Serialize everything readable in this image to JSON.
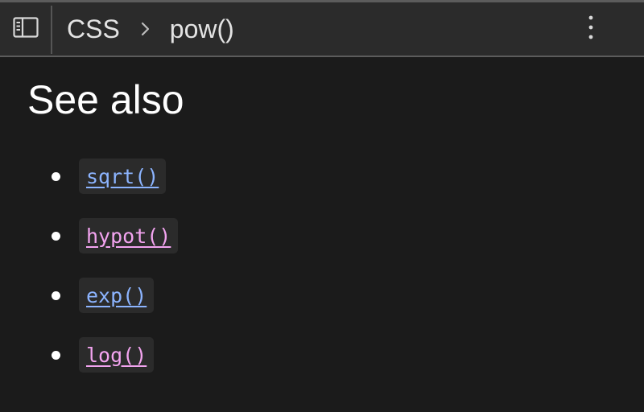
{
  "header": {
    "breadcrumb": [
      {
        "label": "CSS"
      },
      {
        "label": "pow()"
      }
    ]
  },
  "main": {
    "title": "See also",
    "links": [
      {
        "label": "sqrt()",
        "state": "unvisited"
      },
      {
        "label": "hypot()",
        "state": "visited"
      },
      {
        "label": "exp()",
        "state": "unvisited"
      },
      {
        "label": "log()",
        "state": "visited"
      }
    ]
  },
  "colors": {
    "background": "#1b1b1b",
    "toolbar": "#2b2b2b",
    "link_unvisited": "#8cb4ff",
    "link_visited": "#f3a4f0"
  },
  "icons": {
    "sidebar_toggle": "sidebar-toggle-icon",
    "separator": "chevron-right-icon",
    "menu": "more-vertical-icon"
  }
}
